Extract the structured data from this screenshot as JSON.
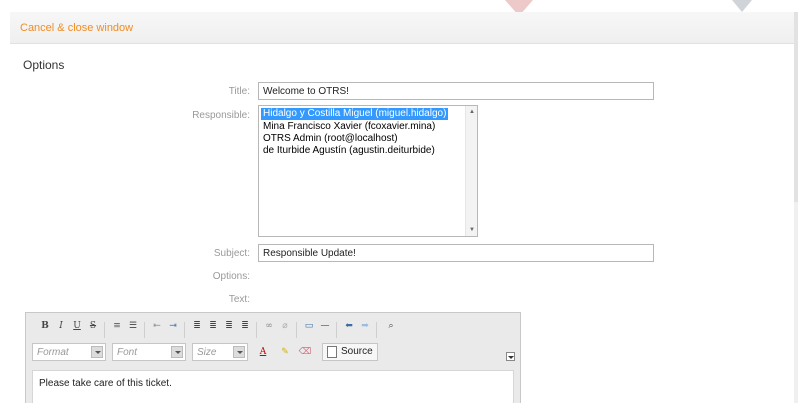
{
  "topbar": {
    "cancel_link": "Cancel & close window"
  },
  "section": {
    "title": "Options"
  },
  "form": {
    "title_label": "Title:",
    "title_value": "Welcome to OTRS!",
    "responsible_label": "Responsible:",
    "responsible_options": [
      "Hidalgo y Costilla Miguel (miguel.hidalgo)",
      "Mina Francisco Xavier (fcoxavier.mina)",
      "OTRS Admin (root@localhost)",
      "de Iturbide Agustín (agustin.deiturbide)"
    ],
    "responsible_selected": "Hidalgo y Costilla Miguel (miguel.hidalgo)",
    "subject_label": "Subject:",
    "subject_value": "Responsible Update!",
    "options_label": "Options:",
    "text_label": "Text:"
  },
  "editor": {
    "format_placeholder": "Format",
    "font_placeholder": "Font",
    "size_placeholder": "Size",
    "source_label": "Source",
    "body_text": "Please take care of this ticket.",
    "toolbar_icons": [
      "bold-icon",
      "italic-icon",
      "underline-icon",
      "strikethrough-icon",
      "numbered-list-icon",
      "bulleted-list-icon",
      "outdent-icon",
      "indent-icon",
      "align-left-icon",
      "align-center-icon",
      "align-right-icon",
      "justify-icon",
      "link-icon",
      "unlink-icon",
      "image-icon",
      "horizontal-rule-icon",
      "undo-icon",
      "redo-icon",
      "find-icon",
      "text-color-icon",
      "background-color-icon",
      "remove-format-icon",
      "source-icon"
    ]
  },
  "colors": {
    "link": "#f28c22",
    "selection": "#3399ff"
  }
}
